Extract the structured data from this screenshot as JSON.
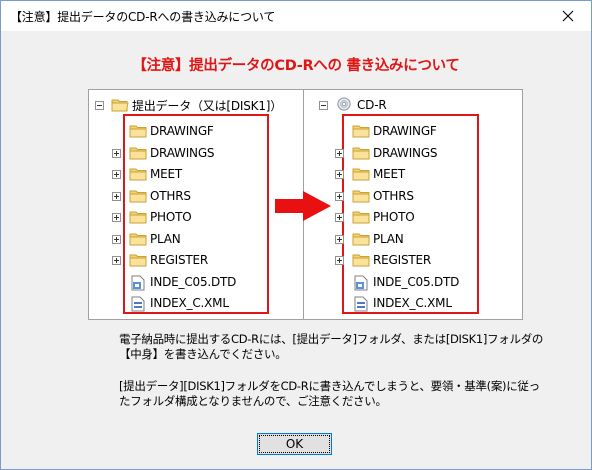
{
  "dialog": {
    "title": "【注意】提出データのCD-Rへの書き込みについて",
    "heading": "【注意】提出データのCD-Rへの 書き込みについて",
    "heading_color": "#e01515"
  },
  "left_tree": {
    "root_label": "提出データ（又は[DISK1]）",
    "items": [
      {
        "label": "DRAWINGF",
        "type": "folder",
        "expandable": false
      },
      {
        "label": "DRAWINGS",
        "type": "folder",
        "expandable": true
      },
      {
        "label": "MEET",
        "type": "folder",
        "expandable": true
      },
      {
        "label": "OTHRS",
        "type": "folder",
        "expandable": true
      },
      {
        "label": "PHOTO",
        "type": "folder",
        "expandable": true
      },
      {
        "label": "PLAN",
        "type": "folder",
        "expandable": true
      },
      {
        "label": "REGISTER",
        "type": "folder",
        "expandable": true
      },
      {
        "label": "INDE_C05.DTD",
        "type": "dtd-file",
        "expandable": false
      },
      {
        "label": "INDEX_C.XML",
        "type": "xml-file",
        "expandable": false
      }
    ]
  },
  "right_tree": {
    "root_label": "CD-R",
    "items": [
      {
        "label": "DRAWINGF",
        "type": "folder",
        "expandable": false
      },
      {
        "label": "DRAWINGS",
        "type": "folder",
        "expandable": true
      },
      {
        "label": "MEET",
        "type": "folder",
        "expandable": true
      },
      {
        "label": "OTHRS",
        "type": "folder",
        "expandable": true
      },
      {
        "label": "PHOTO",
        "type": "folder",
        "expandable": true
      },
      {
        "label": "PLAN",
        "type": "folder",
        "expandable": true
      },
      {
        "label": "REGISTER",
        "type": "folder",
        "expandable": true
      },
      {
        "label": "INDE_C05.DTD",
        "type": "dtd-file",
        "expandable": false
      },
      {
        "label": "INDEX_C.XML",
        "type": "xml-file",
        "expandable": false
      }
    ]
  },
  "message": {
    "para1_line1": "電子納品時に提出するCD-Rには、[提出データ]フォルダ、または[DISK1]フォルダの",
    "para1_line2": "【中身】を書き込んでください。",
    "para2_line1": "[提出データ][DISK1]フォルダをCD-Rに書き込んでしまうと、要領・基準(案)に従っ",
    "para2_line2": "たフォルダ構成となりませんので、ご注意ください。"
  },
  "buttons": {
    "ok_label": "OK",
    "close_icon": "close-x"
  },
  "colors": {
    "highlight_red": "#e01515",
    "folder_yellow": "#f6d36b"
  }
}
